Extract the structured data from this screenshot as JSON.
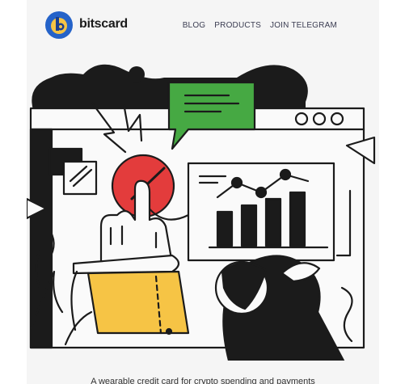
{
  "header": {
    "brand": "bitscard",
    "nav": [
      "BLOG",
      "PRODUCTS",
      "JOIN TELEGRAM"
    ]
  },
  "hero": {
    "caption": "A wearable credit card for crypto spending and payments"
  },
  "colors": {
    "accent_blue": "#2563c9",
    "accent_yellow": "#f6c445",
    "speech_green": "#46a943",
    "click_red": "#e33c3c",
    "ink": "#1b1b1b"
  },
  "icons": [
    "logo-icon",
    "speech-bubble-icon",
    "window-dots-icon",
    "bar-chart-icon",
    "hand-icon"
  ]
}
